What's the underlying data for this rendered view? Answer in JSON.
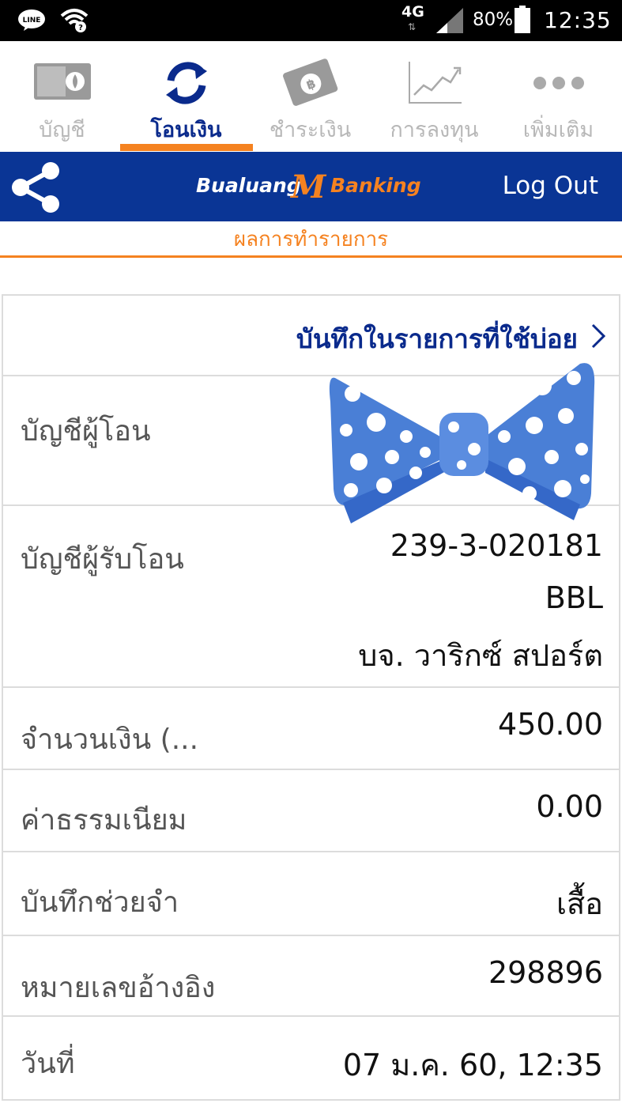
{
  "status_bar": {
    "network": "4G",
    "battery": "80%",
    "time": "12:35",
    "icons": [
      "line-app-icon",
      "wifi-icon",
      "signal-icon",
      "battery-icon"
    ]
  },
  "tabs": [
    {
      "label": "บัญชี",
      "icon": "wallet-icon",
      "active": false
    },
    {
      "label": "โอนเงิน",
      "icon": "transfer-arrows-icon",
      "active": true
    },
    {
      "label": "ชำระเงิน",
      "icon": "bill-payment-icon",
      "active": false
    },
    {
      "label": "การลงทุน",
      "icon": "investment-chart-icon",
      "active": false
    },
    {
      "label": "เพิ่มเติม",
      "icon": "more-dots-icon",
      "active": false
    }
  ],
  "header": {
    "brand_part1": "Bualuang",
    "brand_m": "M",
    "brand_part2": "Banking",
    "logout_label": "Log Out"
  },
  "subtitle": "ผลการทำรายการ",
  "favorite_link": "บันทึกในรายการที่ใช้บ่อย",
  "details": {
    "from_account_label": "บัญชีผู้โอน",
    "to_account_label": "บัญชีผู้รับโอน",
    "to_account_number": "239-3-020181",
    "to_bank": "BBL",
    "to_name": "บจ. วาริกซ์ สปอร์ต",
    "amount_label": "จำนวนเงิน (...",
    "amount_value": "450.00",
    "fee_label": "ค่าธรรมเนียม",
    "fee_value": "0.00",
    "memo_label": "บันทึกช่วยจำ",
    "memo_value": "เสื้อ",
    "reference_label": "หมายเลขอ้างอิง",
    "reference_value": "298896",
    "date_label": "วันที่",
    "date_value": "07 ม.ค. 60, 12:35"
  },
  "colors": {
    "brand_blue": "#0a3595",
    "accent_orange": "#f58220",
    "link_blue": "#0a2a8c",
    "divider": "#dcdcdc"
  }
}
